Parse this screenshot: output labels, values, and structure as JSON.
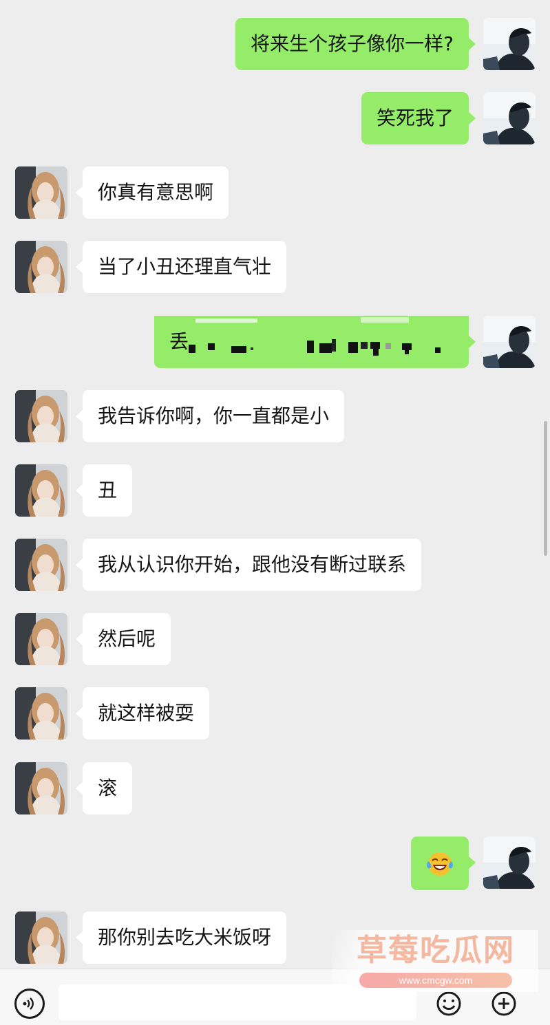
{
  "chat": {
    "messages": [
      {
        "side": "right",
        "text": "将来生个孩子像你一样?"
      },
      {
        "side": "right",
        "text": "笑死我了"
      },
      {
        "side": "left",
        "text": "你真有意思啊"
      },
      {
        "side": "left",
        "text": "当了小丑还理直气壮"
      },
      {
        "side": "right",
        "text": "丢",
        "censored": true
      },
      {
        "side": "left",
        "text": "我告诉你啊，你一直都是小"
      },
      {
        "side": "left",
        "text": "丑"
      },
      {
        "side": "left",
        "text": "我从认识你开始，跟他没有断过联系"
      },
      {
        "side": "left",
        "text": "然后呢"
      },
      {
        "side": "left",
        "text": "就这样被耍"
      },
      {
        "side": "left",
        "text": "滚"
      },
      {
        "side": "right",
        "emoji": "laughing-crying-emoji"
      },
      {
        "side": "left",
        "text": "那你别去吃大米饭呀"
      }
    ]
  },
  "watermark": {
    "title": "草莓吃瓜网",
    "url": "www.cmcgw.com"
  },
  "colors": {
    "background": "#ededed",
    "sent_bubble": "#95ec69",
    "received_bubble": "#ffffff"
  },
  "bottom_bar": {
    "icons": [
      "voice-icon",
      "emoji-icon",
      "plus-icon"
    ]
  }
}
